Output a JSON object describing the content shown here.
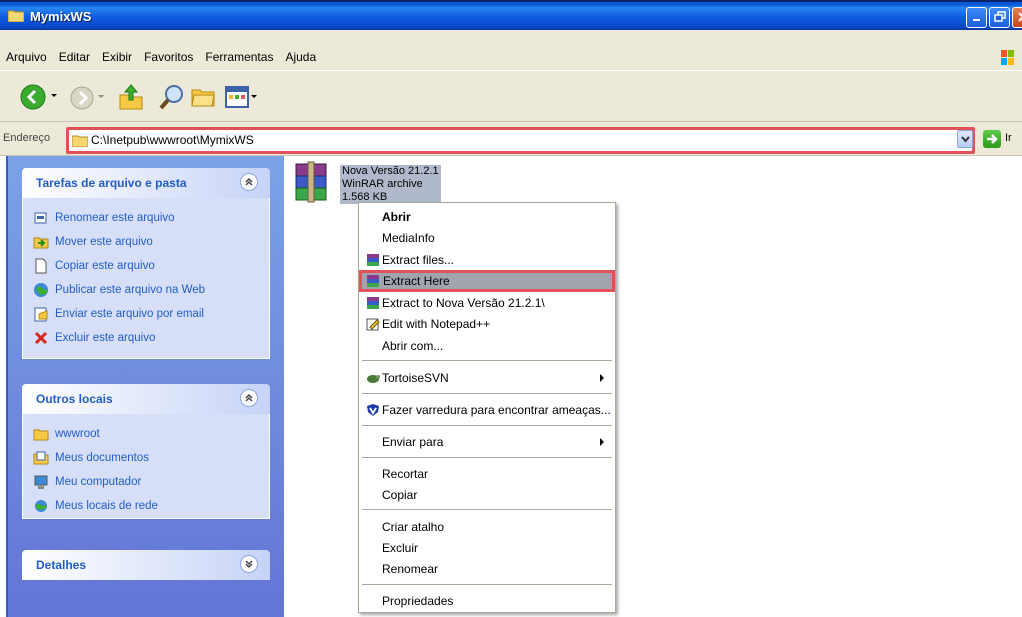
{
  "window": {
    "title": "MymixWS"
  },
  "menu": [
    "Arquivo",
    "Editar",
    "Exibir",
    "Favoritos",
    "Ferramentas",
    "Ajuda"
  ],
  "address": {
    "label": "Endereço",
    "path": "C:\\Inetpub\\wwwroot\\MymixWS",
    "go_label": "Ir"
  },
  "tasks": {
    "title": "Tarefas de arquivo e pasta",
    "items": [
      {
        "label": "Renomear este arquivo",
        "icon": "rename-icon"
      },
      {
        "label": "Mover este arquivo",
        "icon": "move-icon"
      },
      {
        "label": "Copiar este arquivo",
        "icon": "copy-icon"
      },
      {
        "label": "Publicar este arquivo na Web",
        "icon": "publish-web-icon"
      },
      {
        "label": "Enviar este arquivo por email",
        "icon": "email-icon"
      },
      {
        "label": "Excluir este arquivo",
        "icon": "delete-icon"
      }
    ]
  },
  "other_places": {
    "title": "Outros locais",
    "items": [
      {
        "label": "wwwroot",
        "icon": "folder-icon"
      },
      {
        "label": "Meus documentos",
        "icon": "my-documents-icon"
      },
      {
        "label": "Meu computador",
        "icon": "my-computer-icon"
      },
      {
        "label": "Meus locais de rede",
        "icon": "network-places-icon"
      }
    ]
  },
  "details": {
    "title": "Detalhes"
  },
  "file": {
    "name": "Nova Versão 21.2.1",
    "type": "WinRAR archive",
    "size": "1.568 KB"
  },
  "context_menu": {
    "items": [
      {
        "label": "Abrir",
        "bold": true
      },
      {
        "label": "MediaInfo"
      },
      {
        "label": "Extract files...",
        "icon": "winrar-icon"
      },
      {
        "label": "Extract Here",
        "icon": "winrar-icon",
        "highlighted": true
      },
      {
        "label": "Extract to Nova Versão 21.2.1\\",
        "icon": "winrar-icon"
      },
      {
        "label": "Edit with Notepad++",
        "icon": "notepadpp-icon"
      },
      {
        "label": "Abrir com..."
      },
      {
        "label": "TortoiseSVN",
        "icon": "tortoisesvn-icon",
        "submenu": true
      },
      {
        "label": "Fazer varredura para encontrar ameaças...",
        "icon": "antivirus-icon"
      },
      {
        "label": "Enviar para",
        "submenu": true
      },
      {
        "label": "Recortar"
      },
      {
        "label": "Copiar"
      },
      {
        "label": "Criar atalho"
      },
      {
        "label": "Excluir"
      },
      {
        "label": "Renomear"
      },
      {
        "label": "Propriedades"
      }
    ]
  },
  "colors": {
    "highlight_box": "#e0535a",
    "titlebar": "#0d5be1",
    "panel_text": "#215dc6"
  }
}
